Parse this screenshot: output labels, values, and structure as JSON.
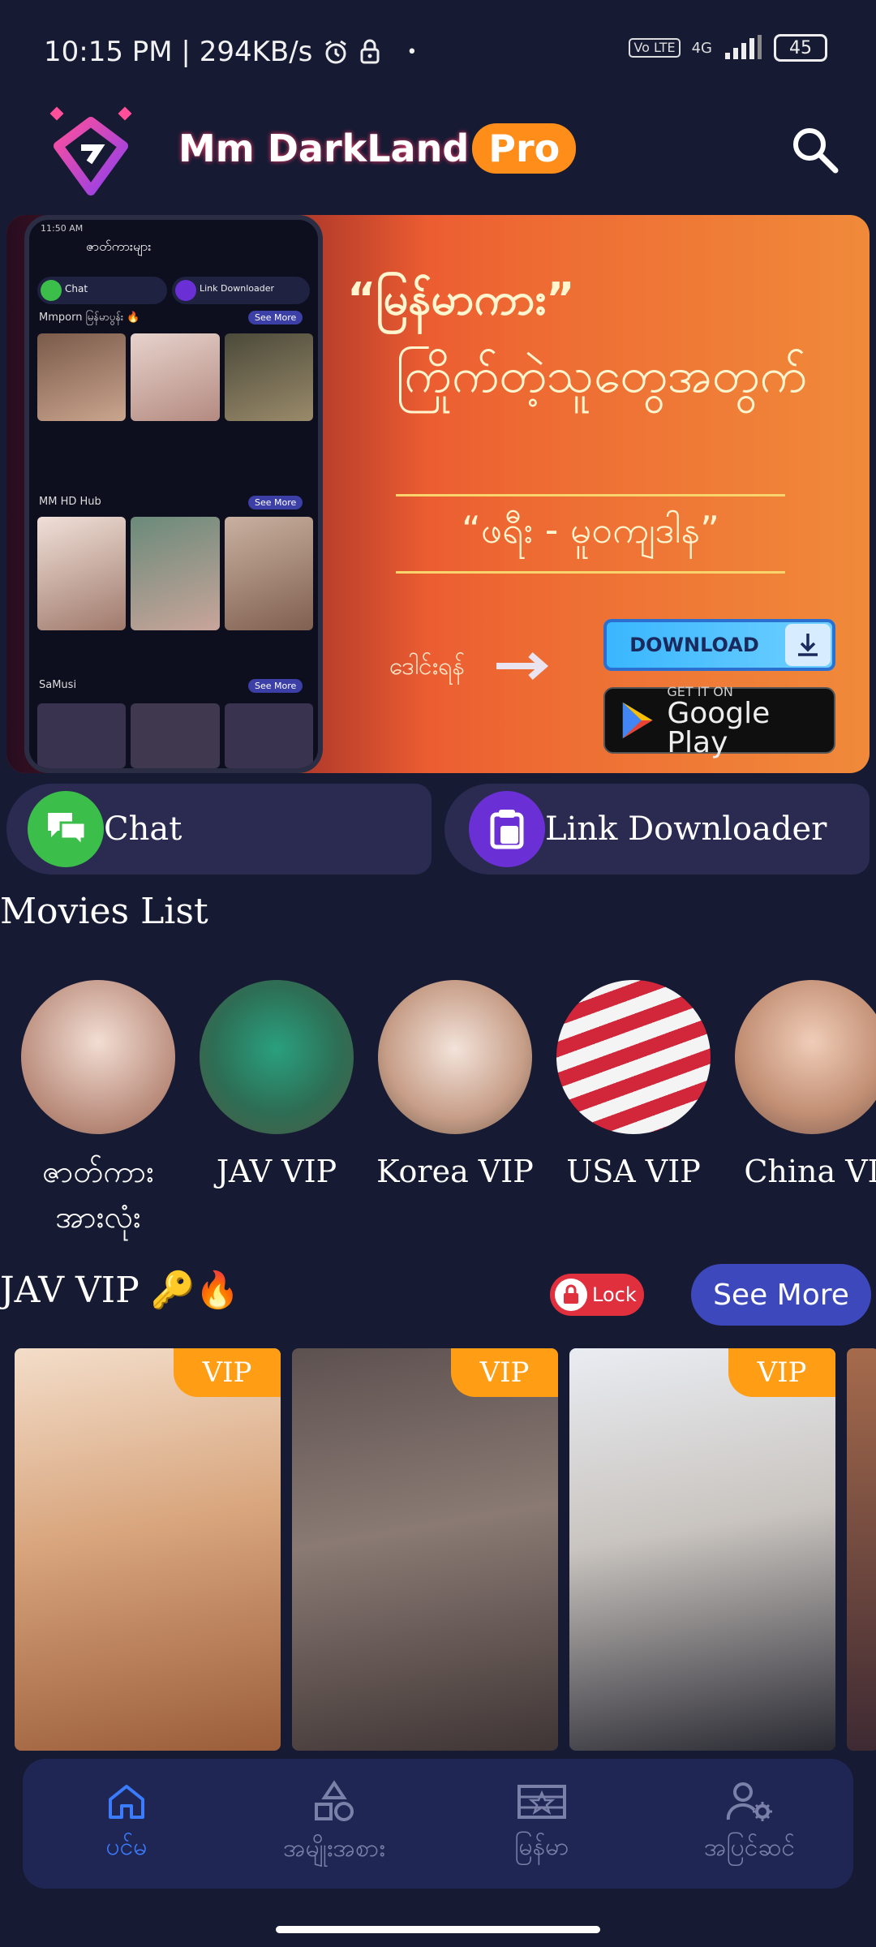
{
  "status": {
    "time": "10:15 PM | 294KB/s",
    "volte": "Vo LTE",
    "network": "4G",
    "battery": "45"
  },
  "header": {
    "title_main": "Mm DarkLand",
    "title_badge": "Pro"
  },
  "banner": {
    "headline": "“မြန်မာကား”",
    "subline": "ကြိုက်တဲ့သူတွေအတွက်",
    "boxed_text": "“ဖရီး - မူဝကျဒါန”",
    "download_label": "DOWNLOAD",
    "arrow_text": "ဒေါင်းရန်",
    "gp_small": "GET IT ON",
    "gp_big": "Google Play",
    "mini_app_title": "ဇာတ်ကားများ",
    "mini_chat": "Chat",
    "mini_link": "Link Downloader",
    "mini_section1": "Mmporn မြန်မာပွန်း 🔥",
    "mini_section2": "MM HD Hub",
    "mini_section3": "SaMusi",
    "mini_see_more": "See More",
    "mini_time": "11:50 AM"
  },
  "quick_actions": {
    "chat": "Chat",
    "link_downloader": "Link Downloader"
  },
  "movies_list": {
    "title": "Movies List",
    "categories": [
      {
        "label": "ဇာတ်ကား\nအားလုံး",
        "color": "#d9b8a8"
      },
      {
        "label": "JAV VIP",
        "color": "#3f8b6b"
      },
      {
        "label": "Korea VIP",
        "color": "#c9a38a"
      },
      {
        "label": "USA VIP",
        "color": "#c23a4a"
      },
      {
        "label": "China VI",
        "color": "#d3a58d"
      }
    ]
  },
  "jav_section": {
    "title": "JAV VIP 🔑🔥",
    "lock_label": "Lock",
    "see_more": "See More",
    "posters": [
      {
        "badge": "VIP"
      },
      {
        "badge": "VIP"
      },
      {
        "badge": "VIP"
      }
    ]
  },
  "bottom_nav": {
    "items": [
      {
        "label": "ပင်မ",
        "icon": "home-icon"
      },
      {
        "label": "အမျိုးအစား",
        "icon": "categories-icon"
      },
      {
        "label": "မြန်မာ",
        "icon": "myanmar-icon"
      },
      {
        "label": "အပြင်ဆင်",
        "icon": "settings-icon"
      }
    ]
  },
  "colors": {
    "background": "#161a33",
    "accent_orange": "#ff9e14",
    "accent_blue": "#3d48bd",
    "lock_red": "#e0303e",
    "chat_green": "#3bbf4a",
    "link_purple": "#6b2fd6"
  }
}
